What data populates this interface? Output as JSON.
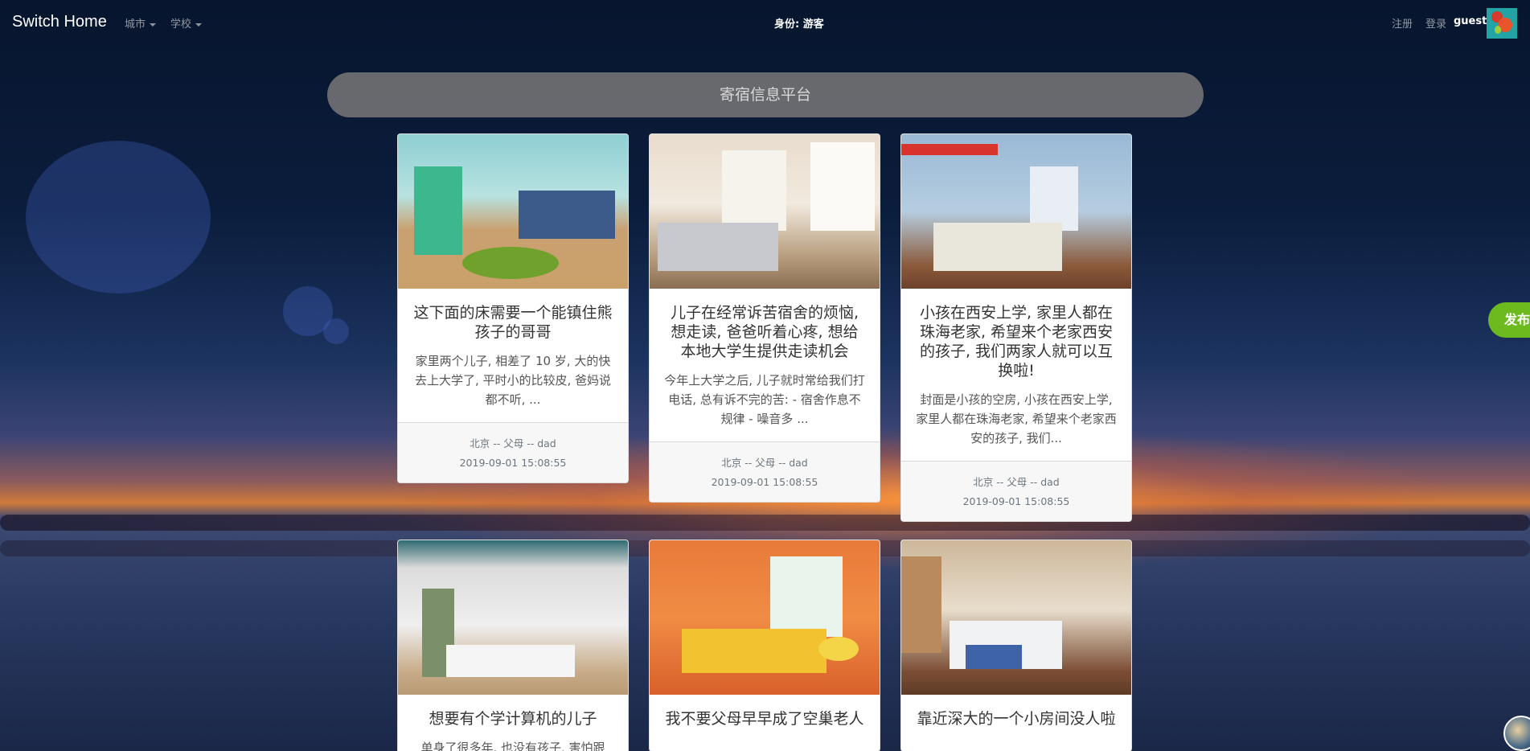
{
  "navbar": {
    "brand": "Switch Home",
    "menu_city": "城市",
    "menu_school": "学校",
    "identity": "身份: 游客",
    "register": "注册",
    "login": "登录",
    "username": "guest"
  },
  "search": {
    "placeholder": "寄宿信息平台"
  },
  "publish_button": "发布",
  "cards": [
    {
      "title": "这下面的床需要一个能镇住熊孩子的哥哥",
      "text": "家里两个儿子, 相差了 10 岁, 大的快去上大学了, 平时小的比较皮, 爸妈说都不听, ...",
      "meta": "北京 -- 父母 -- dad",
      "time": "2019-09-01 15:08:55"
    },
    {
      "title": "儿子在经常诉苦宿舍的烦恼, 想走读, 爸爸听着心疼, 想给本地大学生提供走读机会",
      "text": "今年上大学之后, 儿子就时常给我们打电话, 总有诉不完的苦: - 宿舍作息不规律 - 噪音多 ...",
      "meta": "北京 -- 父母 -- dad",
      "time": "2019-09-01 15:08:55"
    },
    {
      "title": "小孩在西安上学, 家里人都在珠海老家, 希望来个老家西安的孩子, 我们两家人就可以互换啦!",
      "text": "封面是小孩的空房, 小孩在西安上学, 家里人都在珠海老家, 希望来个老家西安的孩子, 我们...",
      "meta": "北京 -- 父母 -- dad",
      "time": "2019-09-01 15:08:55"
    },
    {
      "title": "想要有个学计算机的儿子",
      "text": "单身了很多年, 也没有孩子, 害怕跟",
      "meta": "",
      "time": ""
    },
    {
      "title": "我不要父母早早成了空巢老人",
      "text": "",
      "meta": "",
      "time": ""
    },
    {
      "title": "靠近深大的一个小房间没人啦",
      "text": "",
      "meta": "",
      "time": ""
    }
  ]
}
